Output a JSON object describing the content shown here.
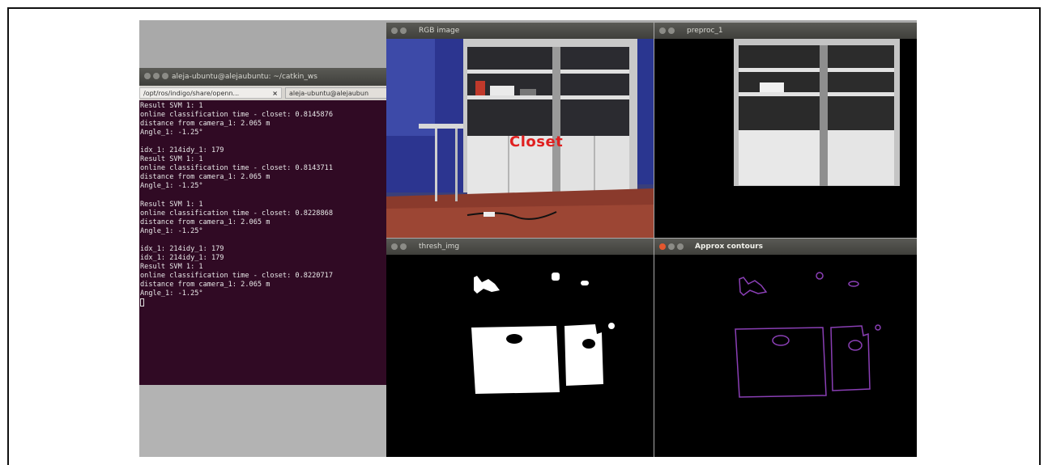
{
  "terminal": {
    "window_title": "aleja-ubuntu@alejaubuntu: ~/catkin_ws",
    "tab1_label": "/opt/ros/indigo/share/openn...",
    "tab1_close": "×",
    "tab2_label": "aleja-ubuntu@alejaubun",
    "lines": [
      "Result SVM 1: 1",
      "online classification time - closet: 0.8145876",
      "distance from camera_1: 2.065 m",
      "Angle_1: -1.25°",
      "",
      "idx_1: 214idy_1: 179",
      "Result SVM 1: 1",
      "online classification time - closet: 0.8143711",
      "distance from camera_1: 2.065 m",
      "Angle_1: -1.25°",
      "",
      "Result SVM 1: 1",
      "online classification time - closet: 0.8228868",
      "distance from camera_1: 2.065 m",
      "Angle_1: -1.25°",
      "",
      "idx_1: 214idy_1: 179",
      "idx_1: 214idy_1: 179",
      "Result SVM 1: 1",
      "online classification time - closet: 0.8220717",
      "distance from camera_1: 2.065 m",
      "Angle_1: -1.25°"
    ]
  },
  "rgb_window": {
    "title": "RGB image",
    "overlay_label": "Closet"
  },
  "preproc_window": {
    "title": "preproc_1"
  },
  "thresh_window": {
    "title": "thresh_img"
  },
  "approx_window": {
    "title": "Approx contours"
  },
  "colors": {
    "terminal_bg": "#300a24",
    "label_red": "#e02020",
    "contour_purple": "#8a3fb5"
  }
}
